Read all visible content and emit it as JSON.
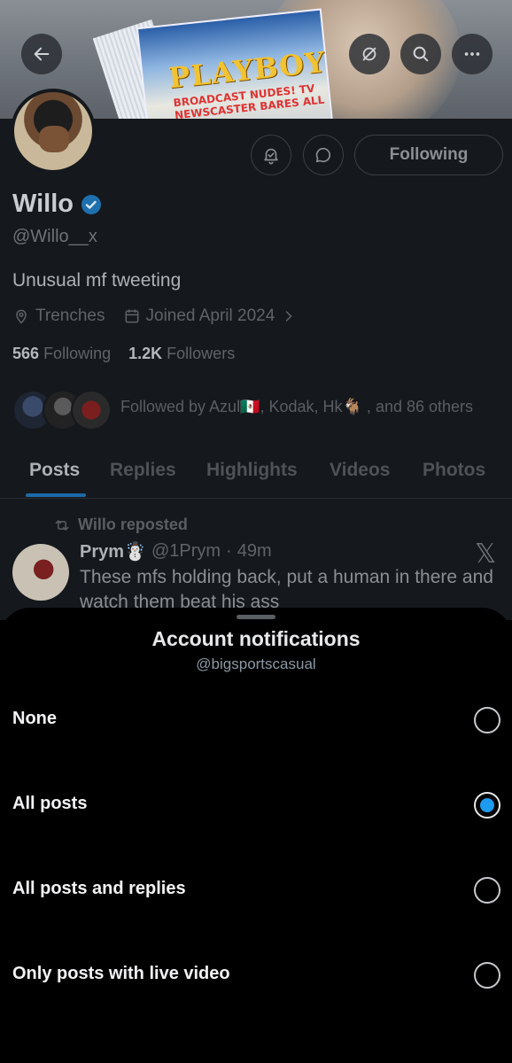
{
  "banner": {
    "magazine_title": "PLAYBOY",
    "magazine_subtitle": "BROADCAST NUDES! TV NEWSCASTER BARES ALL"
  },
  "header": {
    "back_icon": "arrow-left-icon",
    "hide_icon": "eye-slash-icon",
    "search_icon": "search-icon",
    "more_icon": "more-horizontal-icon"
  },
  "profile": {
    "name": "Willo",
    "handle": "@Willo__x",
    "bio": "Unusual mf tweeting",
    "location": "Trenches",
    "joined": "Joined April 2024",
    "following_count": "566",
    "following_label": "Following",
    "followers_count": "1.2K",
    "followers_label": "Followers",
    "followed_by": "Followed by Azul🇲🇽, Kodak, Hk🐐 , and 86 others",
    "following_button": "Following"
  },
  "tabs": [
    "Posts",
    "Replies",
    "Highlights",
    "Videos",
    "Photos"
  ],
  "active_tab": "Posts",
  "post": {
    "repost_label": "Willo reposted",
    "author_name": "Prym☃️",
    "author_handle": "@1Prym",
    "time": "49m",
    "text": "These mfs holding back, put a human in there and watch them beat his ass"
  },
  "sheet": {
    "title": "Account notifications",
    "subtitle": "@bigsportscasual",
    "options": [
      {
        "label": "None",
        "selected": false
      },
      {
        "label": "All posts",
        "selected": true
      },
      {
        "label": "All posts and replies",
        "selected": false
      },
      {
        "label": "Only posts with live video",
        "selected": false
      }
    ]
  },
  "colors": {
    "accent": "#1d9bf0",
    "background": "#000000",
    "dimmed_profile": "#15181c"
  }
}
